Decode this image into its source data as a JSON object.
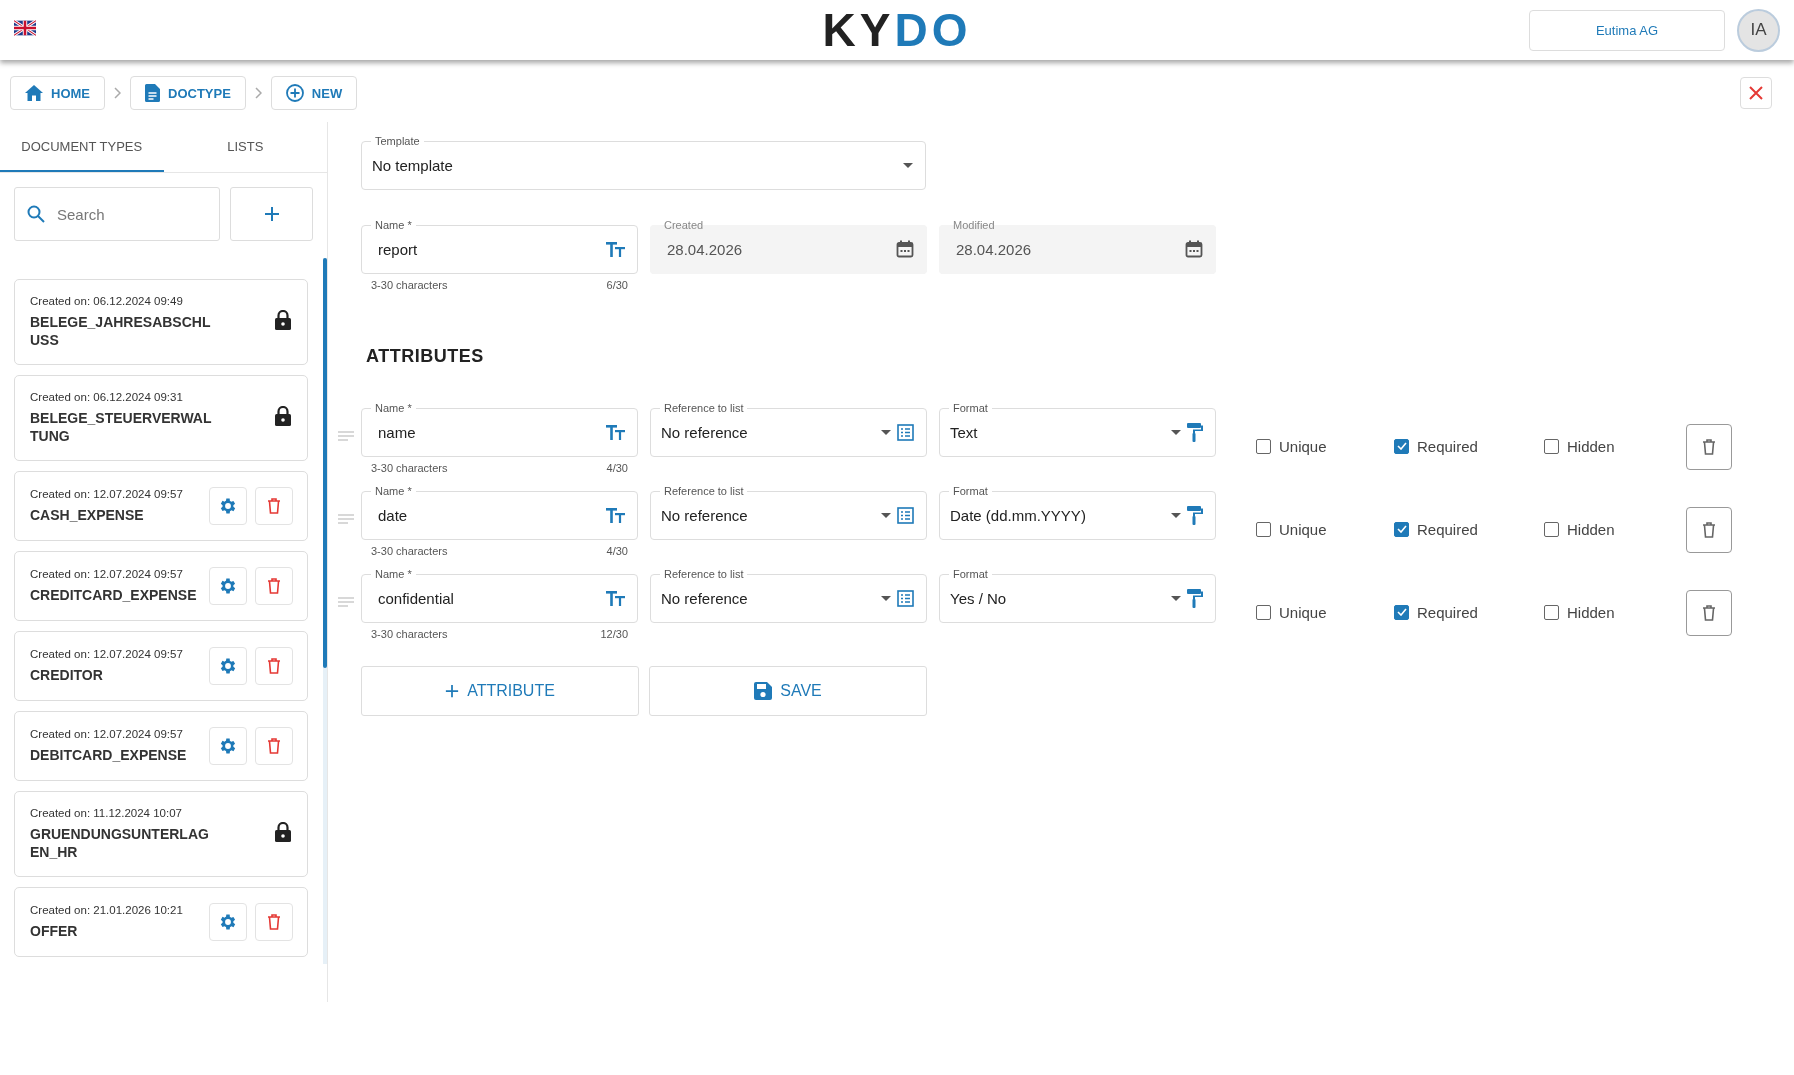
{
  "header": {
    "logo": "KYDO",
    "company": "Eutima AG",
    "avatar": "IA"
  },
  "breadcrumbs": [
    "HOME",
    "DOCTYPE",
    "NEW"
  ],
  "sidebar": {
    "tabs": [
      {
        "label": "DOCUMENT TYPES",
        "selected": true
      },
      {
        "label": "LISTS",
        "selected": false
      }
    ],
    "search": {
      "placeholder": "Search"
    },
    "items": [
      {
        "created": "Created on: 06.12.2024 09:49",
        "name": "BELEGE_JAHRESABSCHLUSS",
        "locked": true
      },
      {
        "created": "Created on: 06.12.2024 09:31",
        "name": "BELEGE_STEUERVERWALTUNG",
        "locked": true
      },
      {
        "created": "Created on: 12.07.2024 09:57",
        "name": "CASH_EXPENSE",
        "locked": false
      },
      {
        "created": "Created on: 12.07.2024 09:57",
        "name": "CREDITCARD_EXPENSE",
        "locked": false
      },
      {
        "created": "Created on: 12.07.2024 09:57",
        "name": "CREDITOR",
        "locked": false
      },
      {
        "created": "Created on: 12.07.2024 09:57",
        "name": "DEBITCARD_EXPENSE",
        "locked": false
      },
      {
        "created": "Created on: 11.12.2024 10:07",
        "name": "GRUENDUNGSUNTERLAGEN_HR",
        "locked": true
      },
      {
        "created": "Created on: 21.01.2026 10:21",
        "name": "OFFER",
        "locked": false
      }
    ]
  },
  "form": {
    "template": {
      "label": "Template",
      "value": "No template"
    },
    "name": {
      "label": "Name *",
      "value": "report",
      "hint": "3-30 characters",
      "counter": "6/30"
    },
    "created": {
      "label": "Created",
      "value": "28.04.2026",
      "disabled": true
    },
    "modified": {
      "label": "Modified",
      "value": "28.04.2026",
      "disabled": true
    }
  },
  "attributes_title": "ATTRIBUTES",
  "attributes": [
    {
      "name_label": "Name *",
      "name": "name",
      "hint": "3-30 characters",
      "counter": "4/30",
      "reference_label": "Reference to list",
      "reference": "No reference",
      "format_label": "Format",
      "format": "Text",
      "options": [
        {
          "label": "Unique",
          "checked": false
        },
        {
          "label": "Required",
          "checked": true
        },
        {
          "label": "Hidden",
          "checked": false
        }
      ]
    },
    {
      "name_label": "Name *",
      "name": "date",
      "hint": "3-30 characters",
      "counter": "4/30",
      "reference_label": "Reference to list",
      "reference": "No reference",
      "format_label": "Format",
      "format": "Date (dd.mm.YYYY)",
      "options": [
        {
          "label": "Unique",
          "checked": false
        },
        {
          "label": "Required",
          "checked": true
        },
        {
          "label": "Hidden",
          "checked": false
        }
      ]
    },
    {
      "name_label": "Name *",
      "name": "confidential",
      "hint": "3-30 characters",
      "counter": "12/30",
      "reference_label": "Reference to list",
      "reference": "No reference",
      "format_label": "Format",
      "format": "Yes / No",
      "options": [
        {
          "label": "Unique",
          "checked": false
        },
        {
          "label": "Required",
          "checked": true
        },
        {
          "label": "Hidden",
          "checked": false
        }
      ]
    }
  ],
  "actions": [
    "ATTRIBUTE",
    "SAVE"
  ]
}
